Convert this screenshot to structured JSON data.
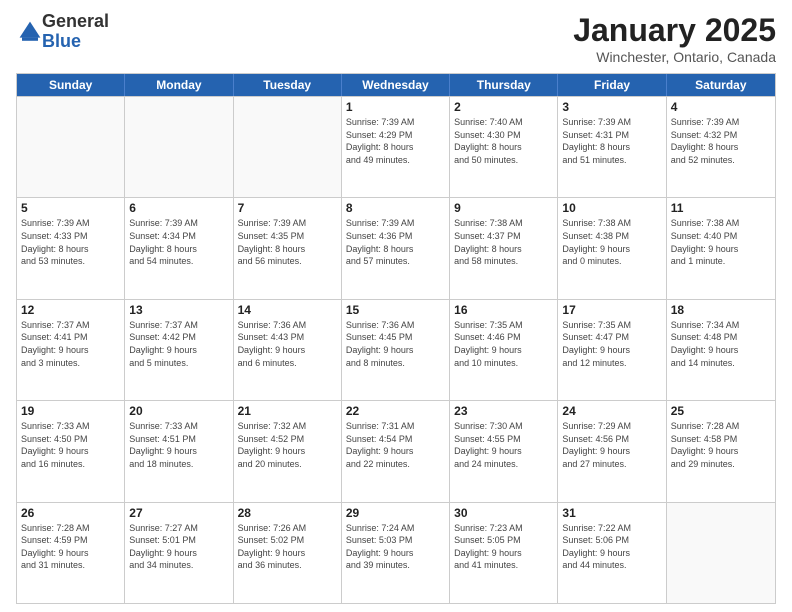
{
  "logo": {
    "general": "General",
    "blue": "Blue"
  },
  "title": "January 2025",
  "subtitle": "Winchester, Ontario, Canada",
  "header": {
    "days": [
      "Sunday",
      "Monday",
      "Tuesday",
      "Wednesday",
      "Thursday",
      "Friday",
      "Saturday"
    ]
  },
  "weeks": [
    [
      {
        "day": "",
        "detail": ""
      },
      {
        "day": "",
        "detail": ""
      },
      {
        "day": "",
        "detail": ""
      },
      {
        "day": "1",
        "detail": "Sunrise: 7:39 AM\nSunset: 4:29 PM\nDaylight: 8 hours\nand 49 minutes."
      },
      {
        "day": "2",
        "detail": "Sunrise: 7:40 AM\nSunset: 4:30 PM\nDaylight: 8 hours\nand 50 minutes."
      },
      {
        "day": "3",
        "detail": "Sunrise: 7:39 AM\nSunset: 4:31 PM\nDaylight: 8 hours\nand 51 minutes."
      },
      {
        "day": "4",
        "detail": "Sunrise: 7:39 AM\nSunset: 4:32 PM\nDaylight: 8 hours\nand 52 minutes."
      }
    ],
    [
      {
        "day": "5",
        "detail": "Sunrise: 7:39 AM\nSunset: 4:33 PM\nDaylight: 8 hours\nand 53 minutes."
      },
      {
        "day": "6",
        "detail": "Sunrise: 7:39 AM\nSunset: 4:34 PM\nDaylight: 8 hours\nand 54 minutes."
      },
      {
        "day": "7",
        "detail": "Sunrise: 7:39 AM\nSunset: 4:35 PM\nDaylight: 8 hours\nand 56 minutes."
      },
      {
        "day": "8",
        "detail": "Sunrise: 7:39 AM\nSunset: 4:36 PM\nDaylight: 8 hours\nand 57 minutes."
      },
      {
        "day": "9",
        "detail": "Sunrise: 7:38 AM\nSunset: 4:37 PM\nDaylight: 8 hours\nand 58 minutes."
      },
      {
        "day": "10",
        "detail": "Sunrise: 7:38 AM\nSunset: 4:38 PM\nDaylight: 9 hours\nand 0 minutes."
      },
      {
        "day": "11",
        "detail": "Sunrise: 7:38 AM\nSunset: 4:40 PM\nDaylight: 9 hours\nand 1 minute."
      }
    ],
    [
      {
        "day": "12",
        "detail": "Sunrise: 7:37 AM\nSunset: 4:41 PM\nDaylight: 9 hours\nand 3 minutes."
      },
      {
        "day": "13",
        "detail": "Sunrise: 7:37 AM\nSunset: 4:42 PM\nDaylight: 9 hours\nand 5 minutes."
      },
      {
        "day": "14",
        "detail": "Sunrise: 7:36 AM\nSunset: 4:43 PM\nDaylight: 9 hours\nand 6 minutes."
      },
      {
        "day": "15",
        "detail": "Sunrise: 7:36 AM\nSunset: 4:45 PM\nDaylight: 9 hours\nand 8 minutes."
      },
      {
        "day": "16",
        "detail": "Sunrise: 7:35 AM\nSunset: 4:46 PM\nDaylight: 9 hours\nand 10 minutes."
      },
      {
        "day": "17",
        "detail": "Sunrise: 7:35 AM\nSunset: 4:47 PM\nDaylight: 9 hours\nand 12 minutes."
      },
      {
        "day": "18",
        "detail": "Sunrise: 7:34 AM\nSunset: 4:48 PM\nDaylight: 9 hours\nand 14 minutes."
      }
    ],
    [
      {
        "day": "19",
        "detail": "Sunrise: 7:33 AM\nSunset: 4:50 PM\nDaylight: 9 hours\nand 16 minutes."
      },
      {
        "day": "20",
        "detail": "Sunrise: 7:33 AM\nSunset: 4:51 PM\nDaylight: 9 hours\nand 18 minutes."
      },
      {
        "day": "21",
        "detail": "Sunrise: 7:32 AM\nSunset: 4:52 PM\nDaylight: 9 hours\nand 20 minutes."
      },
      {
        "day": "22",
        "detail": "Sunrise: 7:31 AM\nSunset: 4:54 PM\nDaylight: 9 hours\nand 22 minutes."
      },
      {
        "day": "23",
        "detail": "Sunrise: 7:30 AM\nSunset: 4:55 PM\nDaylight: 9 hours\nand 24 minutes."
      },
      {
        "day": "24",
        "detail": "Sunrise: 7:29 AM\nSunset: 4:56 PM\nDaylight: 9 hours\nand 27 minutes."
      },
      {
        "day": "25",
        "detail": "Sunrise: 7:28 AM\nSunset: 4:58 PM\nDaylight: 9 hours\nand 29 minutes."
      }
    ],
    [
      {
        "day": "26",
        "detail": "Sunrise: 7:28 AM\nSunset: 4:59 PM\nDaylight: 9 hours\nand 31 minutes."
      },
      {
        "day": "27",
        "detail": "Sunrise: 7:27 AM\nSunset: 5:01 PM\nDaylight: 9 hours\nand 34 minutes."
      },
      {
        "day": "28",
        "detail": "Sunrise: 7:26 AM\nSunset: 5:02 PM\nDaylight: 9 hours\nand 36 minutes."
      },
      {
        "day": "29",
        "detail": "Sunrise: 7:24 AM\nSunset: 5:03 PM\nDaylight: 9 hours\nand 39 minutes."
      },
      {
        "day": "30",
        "detail": "Sunrise: 7:23 AM\nSunset: 5:05 PM\nDaylight: 9 hours\nand 41 minutes."
      },
      {
        "day": "31",
        "detail": "Sunrise: 7:22 AM\nSunset: 5:06 PM\nDaylight: 9 hours\nand 44 minutes."
      },
      {
        "day": "",
        "detail": ""
      }
    ]
  ]
}
